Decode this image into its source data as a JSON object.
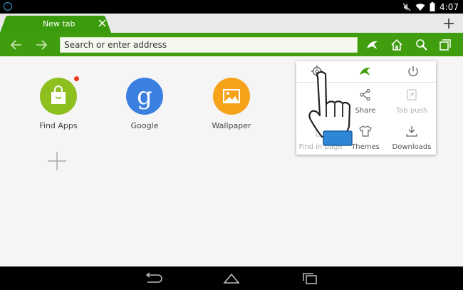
{
  "status_bar": {
    "time": "4:07",
    "icons": [
      "dolphin-notification-icon",
      "mute-icon",
      "wifi-icon",
      "battery-icon"
    ]
  },
  "tab": {
    "title": "New tab"
  },
  "toolbar": {
    "address_placeholder": "Search or enter address",
    "icons": [
      "back-icon",
      "forward-icon",
      "dolphin-icon",
      "home-icon",
      "gesture-icon",
      "tabs-icon"
    ]
  },
  "speed_dial": [
    {
      "label": "Find Apps",
      "color": "#8dbf1f",
      "has_badge": true
    },
    {
      "label": "Google",
      "color": "#3b7fe0"
    },
    {
      "label": "Wallpaper",
      "color": "#f7a21b"
    }
  ],
  "menu": {
    "top_icons": [
      "settings-icon",
      "dolphin-icon",
      "power-icon"
    ],
    "items": [
      {
        "label": "Share",
        "icon": "share-icon",
        "enabled": true
      },
      {
        "label": "Tab push",
        "icon": "tab-push-icon",
        "enabled": false
      },
      {
        "label": "Find in page",
        "icon": "find-in-page-icon",
        "enabled": false
      },
      {
        "label": "Themes",
        "icon": "themes-icon",
        "enabled": true
      },
      {
        "label": "Downloads",
        "icon": "downloads-icon",
        "enabled": true
      }
    ]
  },
  "colors": {
    "toolbar_green": "#3f9d0e",
    "tab_green": "#3a9b0c",
    "badge_red": "#ee3a1b"
  },
  "nav_bar": {
    "buttons": [
      "back-nav-icon",
      "home-nav-icon",
      "recents-nav-icon"
    ]
  }
}
